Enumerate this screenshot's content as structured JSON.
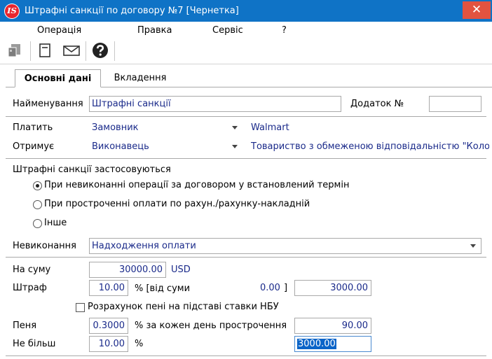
{
  "window": {
    "title": "Штрафні санкції по договору №7 [Чернетка]",
    "app_icon_text": "IS",
    "close_symbol": "✕",
    "accent": "#0f73c6",
    "close_color": "#e25340"
  },
  "menu": {
    "items": [
      "Операція",
      "Правка",
      "Сервіс",
      "?"
    ]
  },
  "toolbar": {
    "icons": [
      "attach-docs-icon",
      "document-icon",
      "envelope-icon",
      "help-icon"
    ]
  },
  "tabs": {
    "items": [
      "Основні дані",
      "Вкладення"
    ],
    "active": "Основні дані"
  },
  "form": {
    "name_label": "Найменування",
    "name_value": "Штрафні санкції",
    "appendix_label": "Додаток №",
    "appendix_value": "",
    "payer_label": "Платить",
    "payer_value": "Замовник",
    "payer_org": "Walmart",
    "receiver_label": "Отримує",
    "receiver_value": "Виконавець",
    "receiver_org": "Товариство з обмеженою відповідальністю \"Колос",
    "applied_label": "Штрафні санкції застосовуються",
    "radios": [
      {
        "label": "При невиконанні операції за договором у встановлений термін",
        "checked": true
      },
      {
        "label": "При простроченні оплати по рахун./рахунку-накладній",
        "checked": false
      },
      {
        "label": "Інше",
        "checked": false
      }
    ],
    "nonfulfillment_label": "Невиконання",
    "nonfulfillment_value": "Надходження оплати",
    "sum_label": "На суму",
    "sum_value": "30000.00",
    "currency": "USD",
    "fine_label": "Штраф",
    "fine_percent": "10.00",
    "fine_percent_text": "%  [від суми",
    "fine_base": "0.00",
    "fine_bracket": "]",
    "fine_amount": "3000.00",
    "nbu_checkbox_label": "Розрахунок пені на підставі ставки НБУ",
    "nbu_checked": false,
    "penalty_label": "Пеня",
    "penalty_percent": "0.3000",
    "penalty_text": "% за кожен день прострочення",
    "penalty_amount": "90.00",
    "max_label": "Не більш",
    "max_percent": "10.00",
    "max_percent_sign": "%",
    "max_amount": "3000.00"
  }
}
